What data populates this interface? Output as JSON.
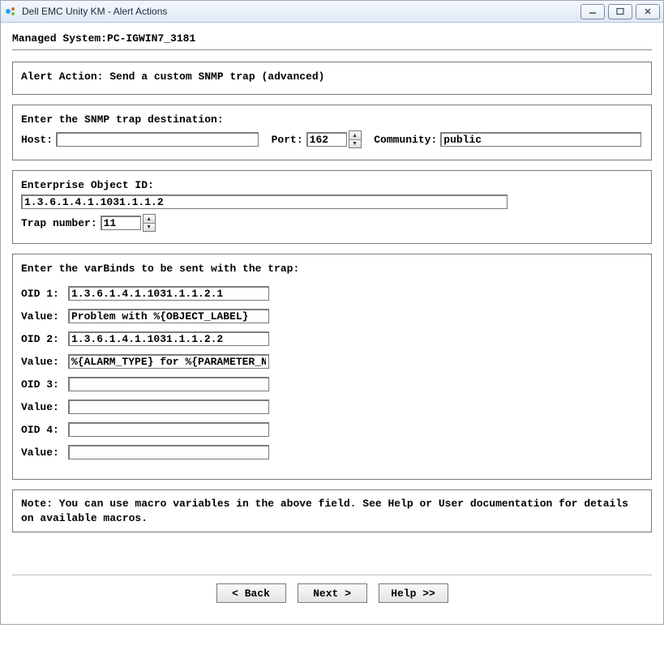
{
  "window": {
    "title": "Dell EMC Unity KM - Alert Actions"
  },
  "managed_label": "Managed System:",
  "managed_value": "PC-IGWIN7_3181",
  "alert_action_label": "Alert Action:",
  "alert_action_value": "Send a custom SNMP trap (advanced)",
  "dest": {
    "title": "Enter the SNMP trap destination:",
    "host_label": "Host:",
    "host_value": "",
    "port_label": "Port:",
    "port_value": "162",
    "community_label": "Community:",
    "community_value": "public"
  },
  "oid_section": {
    "eoid_label": "Enterprise Object ID:",
    "eoid_value": "1.3.6.1.4.1.1031.1.1.2",
    "trap_label": "Trap number:",
    "trap_value": "11"
  },
  "varbinds": {
    "title": "Enter the varBinds to be sent with the trap:",
    "oid1_label": "OID 1:",
    "oid1_value": "1.3.6.1.4.1.1031.1.1.2.1",
    "val1_label": "Value:",
    "val1_value": "Problem with %{OBJECT_LABEL}",
    "oid2_label": "OID 2:",
    "oid2_value": "1.3.6.1.4.1.1031.1.1.2.2",
    "val2_label": "Value:",
    "val2_value": "%{ALARM_TYPE} for %{PARAMETER_N",
    "oid3_label": "OID 3:",
    "oid3_value": "",
    "val3_label": "Value:",
    "val3_value": "",
    "oid4_label": "OID 4:",
    "oid4_value": "",
    "val4_label": "Value:",
    "val4_value": ""
  },
  "note": "Note: You can use macro variables in the above field. See Help or User documentation for details on available macros.",
  "buttons": {
    "back": "< Back",
    "next": "Next >",
    "help": "Help >>"
  }
}
